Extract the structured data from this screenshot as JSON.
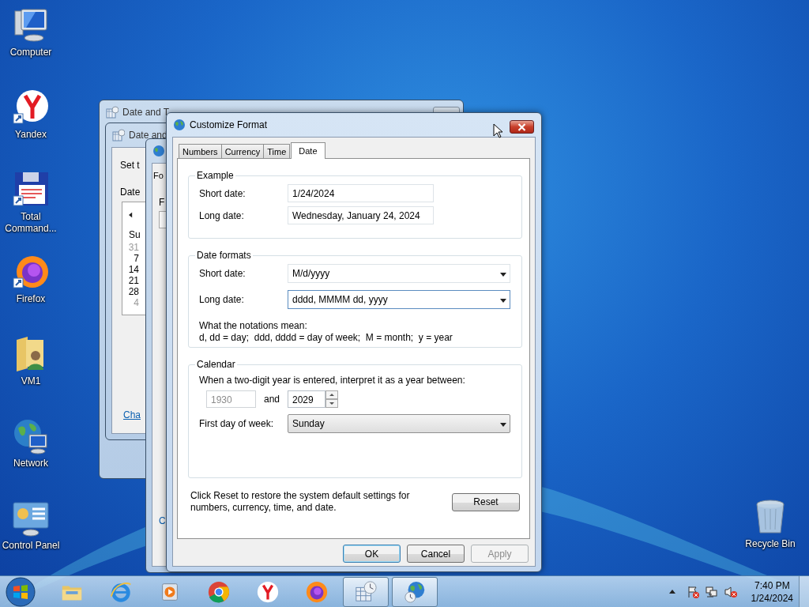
{
  "desktop_icons": [
    {
      "label": "Computer",
      "kind": "computer"
    },
    {
      "label": "Yandex",
      "kind": "yandex"
    },
    {
      "label": "Total Command...",
      "kind": "floppy"
    },
    {
      "label": "Firefox",
      "kind": "firefox"
    },
    {
      "label": "VM1",
      "kind": "folder"
    },
    {
      "label": "Network",
      "kind": "network"
    },
    {
      "label": "Control Panel",
      "kind": "panel"
    }
  ],
  "recycle_bin": {
    "label": "Recycle Bin"
  },
  "background_windows": {
    "outer_title": "Date and T",
    "inner_title": "Date and",
    "set_text": "Set t",
    "date_label": "Date",
    "calendar_header": "Su",
    "calendar_days": [
      {
        "day": "31",
        "muted": true
      },
      {
        "day": "7",
        "muted": false
      },
      {
        "day": "14",
        "muted": false
      },
      {
        "day": "21",
        "muted": false
      },
      {
        "day": "28",
        "muted": false
      },
      {
        "day": "4",
        "muted": true
      }
    ],
    "link": "Cha",
    "region_tab": "Fo",
    "region_label": "F",
    "region_link": "C"
  },
  "dialog": {
    "title": "Customize Format",
    "tabs": [
      {
        "label": "Numbers",
        "selected": false
      },
      {
        "label": "Currency",
        "selected": false
      },
      {
        "label": "Time",
        "selected": false
      },
      {
        "label": "Date",
        "selected": true
      }
    ],
    "example": {
      "legend": "Example",
      "rows": [
        {
          "label": "Short date:",
          "value": "1/24/2024"
        },
        {
          "label": "Long date:",
          "value": "Wednesday, January 24, 2024"
        }
      ]
    },
    "date_formats": {
      "legend": "Date formats",
      "rows": [
        {
          "label": "Short date:",
          "value": "M/d/yyyy",
          "focused": false
        },
        {
          "label": "Long date:",
          "value": "dddd, MMMM dd, yyyy",
          "focused": true
        }
      ],
      "notes_title": "What the notations mean:",
      "notes": "d, dd = day;  ddd, dddd = day of week;  M = month;  y = year"
    },
    "calendar": {
      "legend": "Calendar",
      "prompt": "When a two-digit year is entered, interpret it as a year between:",
      "from_year": {
        "value": "1930",
        "disabled": true
      },
      "and": "and",
      "to_year": {
        "value": "2029",
        "disabled": false
      },
      "first_day_label": "First day of week:",
      "first_day": "Sunday"
    },
    "reset_note": "Click Reset to restore the system default settings for numbers, currency, time, and date.",
    "reset_button": "Reset",
    "buttons": [
      {
        "label": "OK",
        "default": true,
        "disabled": false
      },
      {
        "label": "Cancel",
        "default": false,
        "disabled": false
      },
      {
        "label": "Apply",
        "default": false,
        "disabled": true
      }
    ]
  },
  "taskbar": {
    "items": [
      {
        "kind": "explorer",
        "active": false
      },
      {
        "kind": "ie",
        "active": false
      },
      {
        "kind": "media",
        "active": false
      },
      {
        "kind": "chrome",
        "active": false
      },
      {
        "kind": "yandex",
        "active": false
      },
      {
        "kind": "firefox",
        "active": false
      },
      {
        "kind": "datetime",
        "active": true
      },
      {
        "kind": "region",
        "active": true
      }
    ],
    "time": "7:40 PM",
    "date": "1/24/2024"
  }
}
